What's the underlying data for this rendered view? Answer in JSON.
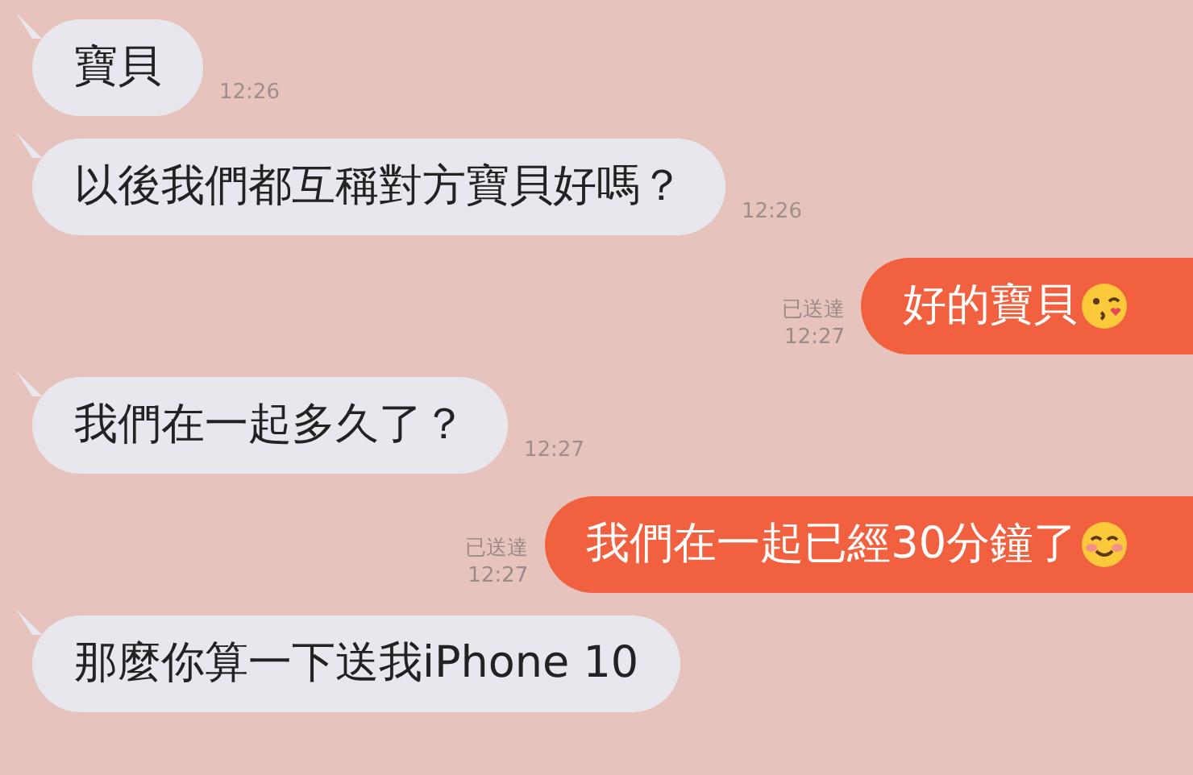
{
  "messages": [
    {
      "kind": "received",
      "text": "寶貝",
      "time": "12:26"
    },
    {
      "kind": "received",
      "text": "以後我們都互稱對方寶貝好嗎？",
      "time": "12:26"
    },
    {
      "kind": "sent",
      "text": "好的寶貝",
      "emoji": {
        "kind": "kiss"
      },
      "status": "已送達",
      "time": "12:27"
    },
    {
      "kind": "received",
      "text": "我們在一起多久了？",
      "time": "12:27"
    },
    {
      "kind": "sent",
      "text": "我們在一起已經30分鐘了",
      "emoji": {
        "kind": "smile"
      },
      "status": "已送達",
      "time": "12:27"
    },
    {
      "kind": "received",
      "text": "那麼你算一下送我iPhone 10"
    }
  ]
}
